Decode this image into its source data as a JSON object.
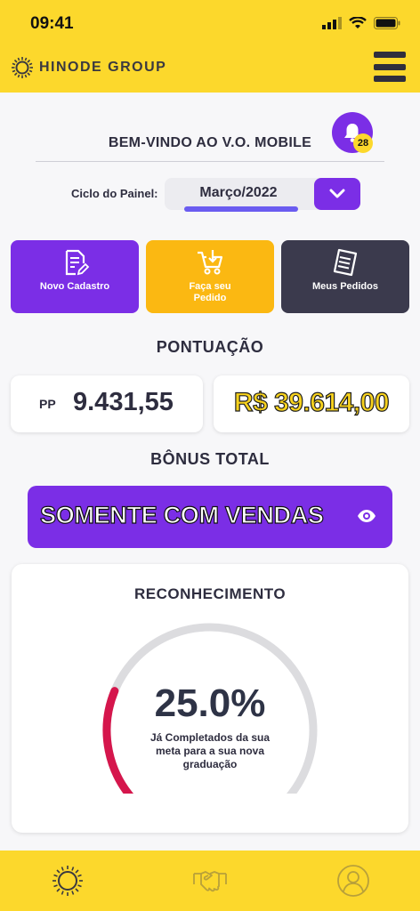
{
  "status_bar": {
    "time": "09:41"
  },
  "header": {
    "brand": "HINODE GROUP"
  },
  "welcome": {
    "title": "BEM-VINDO AO V.O. MOBILE",
    "notifications_count": "28"
  },
  "cycle": {
    "label": "Ciclo do Painel:",
    "selected": "Março/2022"
  },
  "actions": [
    {
      "label": "Novo Cadastro",
      "icon": "document-edit-icon"
    },
    {
      "label": "Faça seu Pedido",
      "icon": "cart-download-icon"
    },
    {
      "label": "Meus Pedidos",
      "icon": "receipt-list-icon"
    }
  ],
  "pontuacao": {
    "title": "PONTUAÇÃO",
    "pp_label": "PP",
    "pp_value": "9.431,55",
    "rs_value": "R$ 39.614,00"
  },
  "bonus": {
    "title": "BÔNUS TOTAL",
    "text": "SOMENTE COM VENDAS"
  },
  "reconhecimento": {
    "title": "RECONHECIMENTO",
    "percent_text": "25.0%",
    "progress": 0.25,
    "subtitle": "Já Completados da sua meta para a sua nova graduação"
  },
  "bottom_nav": [
    {
      "icon": "hinode-sun-icon"
    },
    {
      "icon": "handshake-icon"
    },
    {
      "icon": "profile-icon"
    }
  ],
  "colors": {
    "brand_yellow": "#fcd82c",
    "accent_purple": "#7b2ee6",
    "order_orange": "#fbb812",
    "dark_slate": "#3b3a4d",
    "gauge_red": "#d5164c",
    "gauge_track": "#dcdcdf"
  }
}
